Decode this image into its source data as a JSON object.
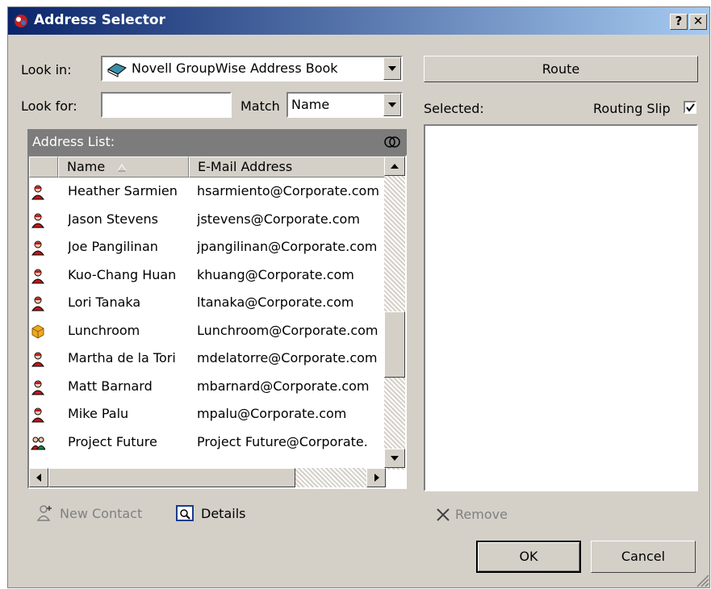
{
  "window": {
    "title": "Address Selector",
    "help_label": "?",
    "close_label": "✕"
  },
  "look_in": {
    "label": "Look in:",
    "value": "Novell GroupWise Address Book"
  },
  "look_for": {
    "label": "Look for:",
    "value": "",
    "match_label": "Match",
    "match_value": "Name"
  },
  "address_list": {
    "title": "Address List:",
    "columns": {
      "name": "Name",
      "email": "E-Mail Address"
    },
    "rows": [
      {
        "name": "Heather Sarmien",
        "email": "hsarmiento@Corporate.com",
        "type": "user"
      },
      {
        "name": "Jason Stevens",
        "email": "jstevens@Corporate.com",
        "type": "user"
      },
      {
        "name": "Joe Pangilinan",
        "email": "jpangilinan@Corporate.com",
        "type": "user"
      },
      {
        "name": "Kuo-Chang Huan",
        "email": "khuang@Corporate.com",
        "type": "user"
      },
      {
        "name": "Lori Tanaka",
        "email": "ltanaka@Corporate.com",
        "type": "user"
      },
      {
        "name": "Lunchroom",
        "email": "Lunchroom@Corporate.com",
        "type": "resource"
      },
      {
        "name": "Martha de la Tori",
        "email": "mdelatorre@Corporate.com",
        "type": "user"
      },
      {
        "name": "Matt Barnard",
        "email": "mbarnard@Corporate.com",
        "type": "user"
      },
      {
        "name": "Mike Palu",
        "email": "mpalu@Corporate.com",
        "type": "user"
      },
      {
        "name": "Project Future",
        "email": "Project Future@Corporate.",
        "type": "group"
      }
    ]
  },
  "actions": {
    "new_contact": "New Contact",
    "details": "Details",
    "remove": "Remove"
  },
  "route": {
    "button_label": "Route",
    "selected_label": "Selected:",
    "routing_slip_label": "Routing Slip",
    "routing_slip_checked": true
  },
  "footer": {
    "ok_label": "OK",
    "cancel_label": "Cancel"
  }
}
